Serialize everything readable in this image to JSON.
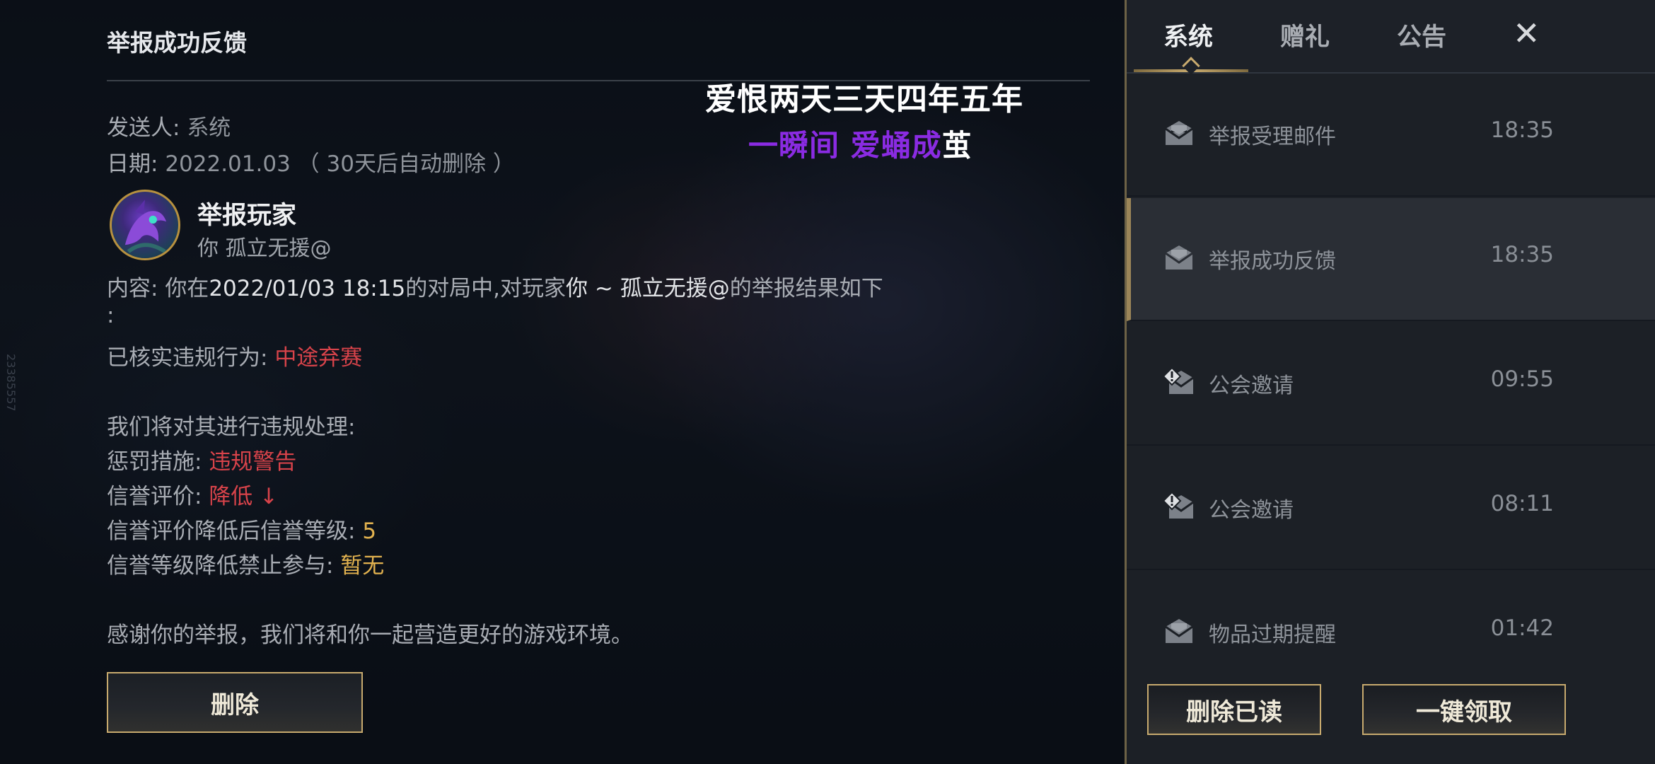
{
  "mail": {
    "title": "举报成功反馈",
    "sender_label": "发送人:",
    "sender_value": "系统",
    "date_label": "日期:",
    "date_value": "2022.01.03",
    "date_note": "（ 30天后自动删除 ）",
    "reporter_title": "举报玩家",
    "reporter_sub": "你 孤立无援@",
    "content_label": "内容:",
    "content_part1": "你在",
    "content_datetime": "2022/01/03 18:15",
    "content_part2": "的对局中,对玩家",
    "content_player": "你 ~ 孤立无援@",
    "content_part3": "的举报结果如下",
    "content_colon": ":",
    "verified_label": "已核实违规行为:",
    "verified_value": "中途弃赛",
    "process_intro": "我们将对其进行违规处理:",
    "penalty_label": "惩罚措施:",
    "penalty_value": "违规警告",
    "credit_label": "信誉评价:",
    "credit_value": "降低 ↓",
    "credit_level_label": "信誉评价降低后信誉等级:",
    "credit_level_value": "5",
    "ban_label": "信誉等级降低禁止参与:",
    "ban_value": "暂无",
    "thanks": "感谢你的举报，我们将和你一起营造更好的游戏环境。",
    "delete_label": "删除"
  },
  "overlay": {
    "line1": "爱恨两天三天四年五年",
    "line2_purple": "一瞬间 爱蛹成",
    "line2_white": "茧"
  },
  "watermark": "23385557",
  "panel": {
    "tabs": [
      {
        "label": "系统",
        "active": true
      },
      {
        "label": "赠礼",
        "active": false
      },
      {
        "label": "公告",
        "active": false
      }
    ],
    "close_label": "✕",
    "items": [
      {
        "title": "举报受理邮件",
        "time": "18:35",
        "icon": "mail-read-icon",
        "selected": false
      },
      {
        "title": "举报成功反馈",
        "time": "18:35",
        "icon": "mail-read-icon",
        "selected": true
      },
      {
        "title": "公会邀请",
        "time": "09:55",
        "icon": "mail-alert-icon",
        "selected": false
      },
      {
        "title": "公会邀请",
        "time": "08:11",
        "icon": "mail-alert-icon",
        "selected": false
      },
      {
        "title": "物品过期提醒",
        "time": "01:42",
        "icon": "mail-read-icon",
        "selected": false
      }
    ],
    "delete_read_label": "删除已读",
    "claim_all_label": "一键领取"
  },
  "colors": {
    "accent_gold": "#c8aa6e",
    "warning_red": "#d8434a",
    "highlight_gold": "#e2b24f",
    "overlay_purple": "#8a2be2"
  }
}
